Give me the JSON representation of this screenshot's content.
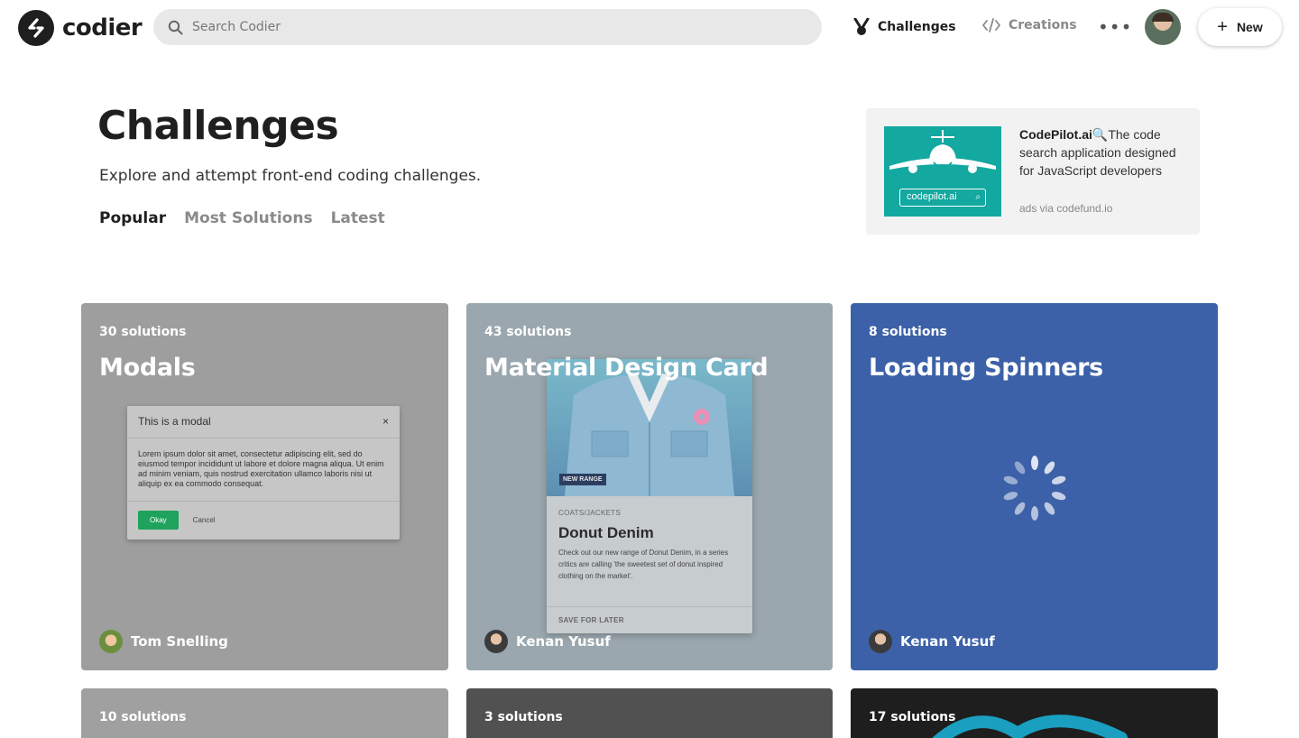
{
  "header": {
    "logo_text": "codier",
    "search_placeholder": "Search Codier",
    "nav": {
      "challenges": "Challenges",
      "creations": "Creations"
    },
    "more": "•••",
    "new_label": "New"
  },
  "hero": {
    "title": "Challenges",
    "subtitle": "Explore and attempt front-end coding challenges.",
    "tabs": [
      "Popular",
      "Most Solutions",
      "Latest"
    ],
    "active_tab": "Popular"
  },
  "ad": {
    "brand": "CodePilot.ai",
    "emoji": "🔍",
    "text": "The code search application designed for JavaScript developers",
    "image_domain": "codepilot.ai",
    "via": "ads via codefund.io"
  },
  "cards": [
    {
      "count": "30 solutions",
      "title": "Modals",
      "author": "Tom Snelling",
      "bg": "#9e9e9e"
    },
    {
      "count": "43 solutions",
      "title": "Material Design Card",
      "author": "Kenan Yusuf",
      "bg": "#9aa7ae"
    },
    {
      "count": "8 solutions",
      "title": "Loading Spinners",
      "author": "Kenan Yusuf",
      "bg": "#3c61a8"
    },
    {
      "count": "10 solutions",
      "bg": "#a0a0a0"
    },
    {
      "count": "3 solutions",
      "bg": "#515151"
    },
    {
      "count": "17 solutions",
      "bg": "#1e1e1e"
    }
  ],
  "modal_preview": {
    "title": "This is a modal",
    "close": "×",
    "body": "Lorem ipsum dolor sit amet, consectetur adipiscing elit, sed do eiusmod tempor incididunt ut labore et dolore magna aliqua. Ut enim ad minim veniam, quis nostrud exercitation ullamco laboris nisi ut aliquip ex ea commodo consequat.",
    "ok": "Okay",
    "cancel": "Cancel"
  },
  "material_preview": {
    "badge": "NEW RANGE",
    "category": "COATS/JACKETS",
    "name": "Donut Denim",
    "description": "Check out our new range of Donut Denim, in a series critics are calling 'the sweetest set of donut inspired clothing on the market'.",
    "action": "SAVE FOR LATER"
  }
}
